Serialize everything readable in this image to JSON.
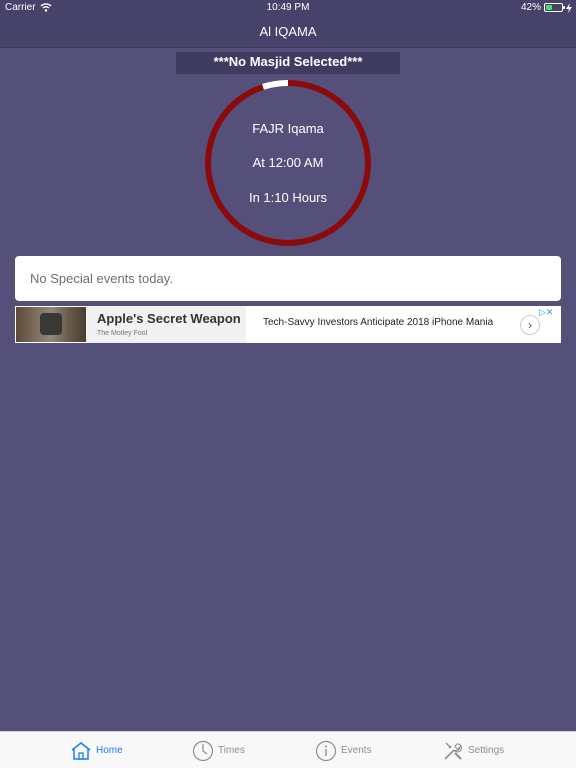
{
  "status_bar": {
    "carrier": "Carrier",
    "time": "10:49 PM",
    "battery": "42%",
    "battery_level": 0.42
  },
  "nav": {
    "title": "Al IQAMA"
  },
  "masjid": {
    "label": "***No Masjid Selected***"
  },
  "countdown": {
    "line1": "FAJR Iqama",
    "line2": "At 12:00 AM",
    "line3": "In 1:10 Hours",
    "ring_color": "#8b0a0c",
    "progress_color": "#ffffff"
  },
  "events": {
    "message": "No Special events today."
  },
  "ad": {
    "title": "Apple's Secret Weapon",
    "source": "The Motley Fool",
    "text": "Tech-Savvy Investors Anticipate 2018 iPhone Mania",
    "arrow": "›",
    "choices": "▷✕",
    "logo_glyph": ""
  },
  "tabs": [
    {
      "label": "Home",
      "icon": "home-icon",
      "active": true
    },
    {
      "label": "Times",
      "icon": "clock-icon",
      "active": false
    },
    {
      "label": "Events",
      "icon": "info-icon",
      "active": false
    },
    {
      "label": "Settings",
      "icon": "tools-icon",
      "active": false
    }
  ]
}
